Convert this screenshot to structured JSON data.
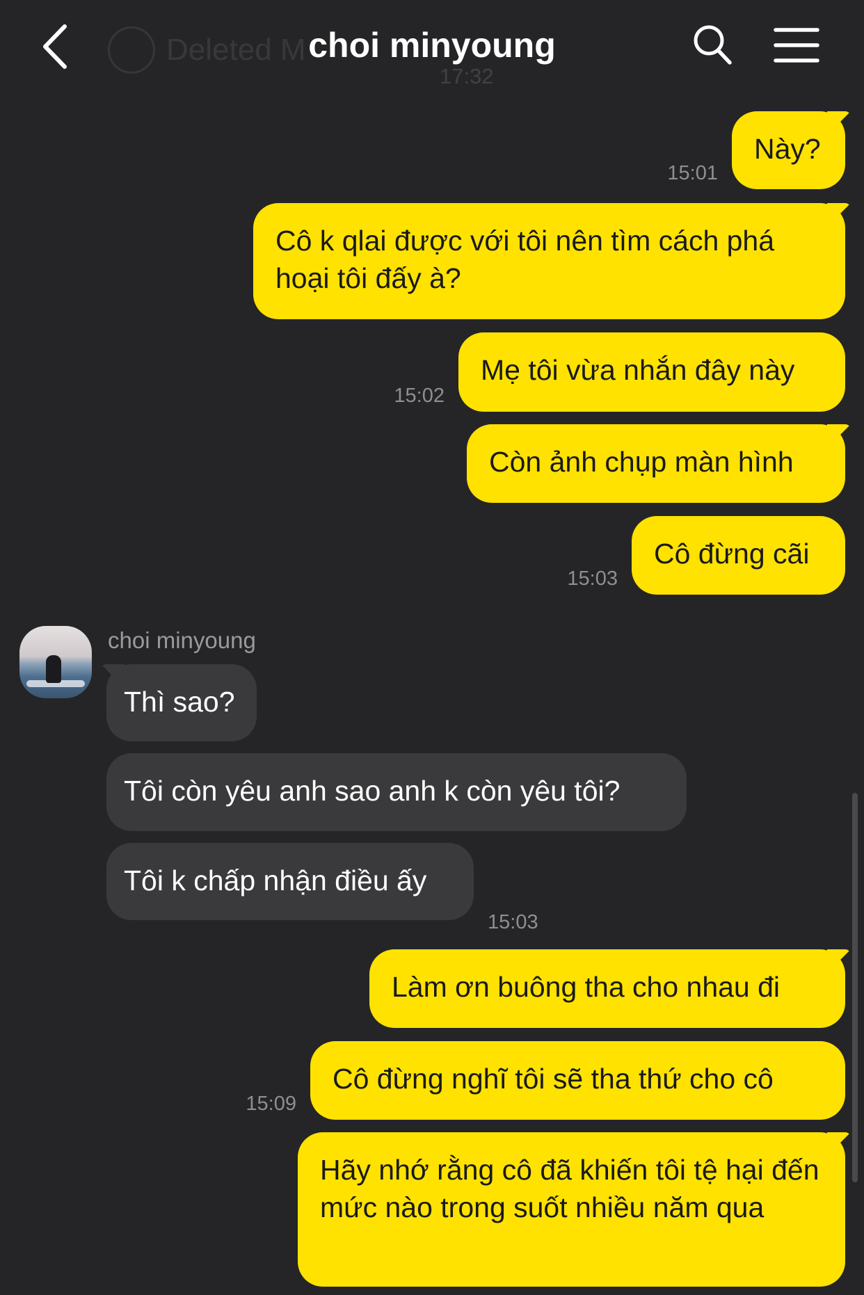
{
  "header": {
    "title": "choi minyoung",
    "ghost_text": "Deleted M",
    "ghost_time": "17:32"
  },
  "icons": {
    "back": "back-chevron-icon",
    "search": "search-icon",
    "menu": "hamburger-menu-icon"
  },
  "colors": {
    "background": "#252527",
    "outgoing_bubble": "#ffe200",
    "incoming_bubble": "#3a3a3c",
    "timestamp": "#8e8e93"
  },
  "messages": [
    {
      "dir": "out",
      "text": "Này?",
      "time": "15:01"
    },
    {
      "dir": "out",
      "text": "Cô k qlai được với tôi nên tìm cách phá hoại tôi đấy à?",
      "time": ""
    },
    {
      "dir": "out",
      "text": "Mẹ tôi vừa nhắn đây này",
      "time": "15:02"
    },
    {
      "dir": "out",
      "text": "Còn ảnh chụp màn hình",
      "time": ""
    },
    {
      "dir": "out",
      "text": "Cô đừng cãi",
      "time": "15:03"
    },
    {
      "dir": "in",
      "sender": "choi minyoung",
      "text": "Thì sao?",
      "time": ""
    },
    {
      "dir": "in",
      "text": "Tôi còn yêu anh sao anh k còn yêu tôi?",
      "time": ""
    },
    {
      "dir": "in",
      "text": "Tôi k chấp nhận điều ấy",
      "time": "15:03"
    },
    {
      "dir": "out",
      "text": "Làm ơn buông tha cho nhau đi",
      "time": ""
    },
    {
      "dir": "out",
      "text": "Cô đừng nghĩ tôi sẽ tha thứ cho cô",
      "time": "15:09"
    },
    {
      "dir": "out",
      "text": "Hãy nhớ rằng cô đã khiến tôi tệ hại đến mức nào trong suốt nhiều năm qua",
      "time": ""
    }
  ]
}
